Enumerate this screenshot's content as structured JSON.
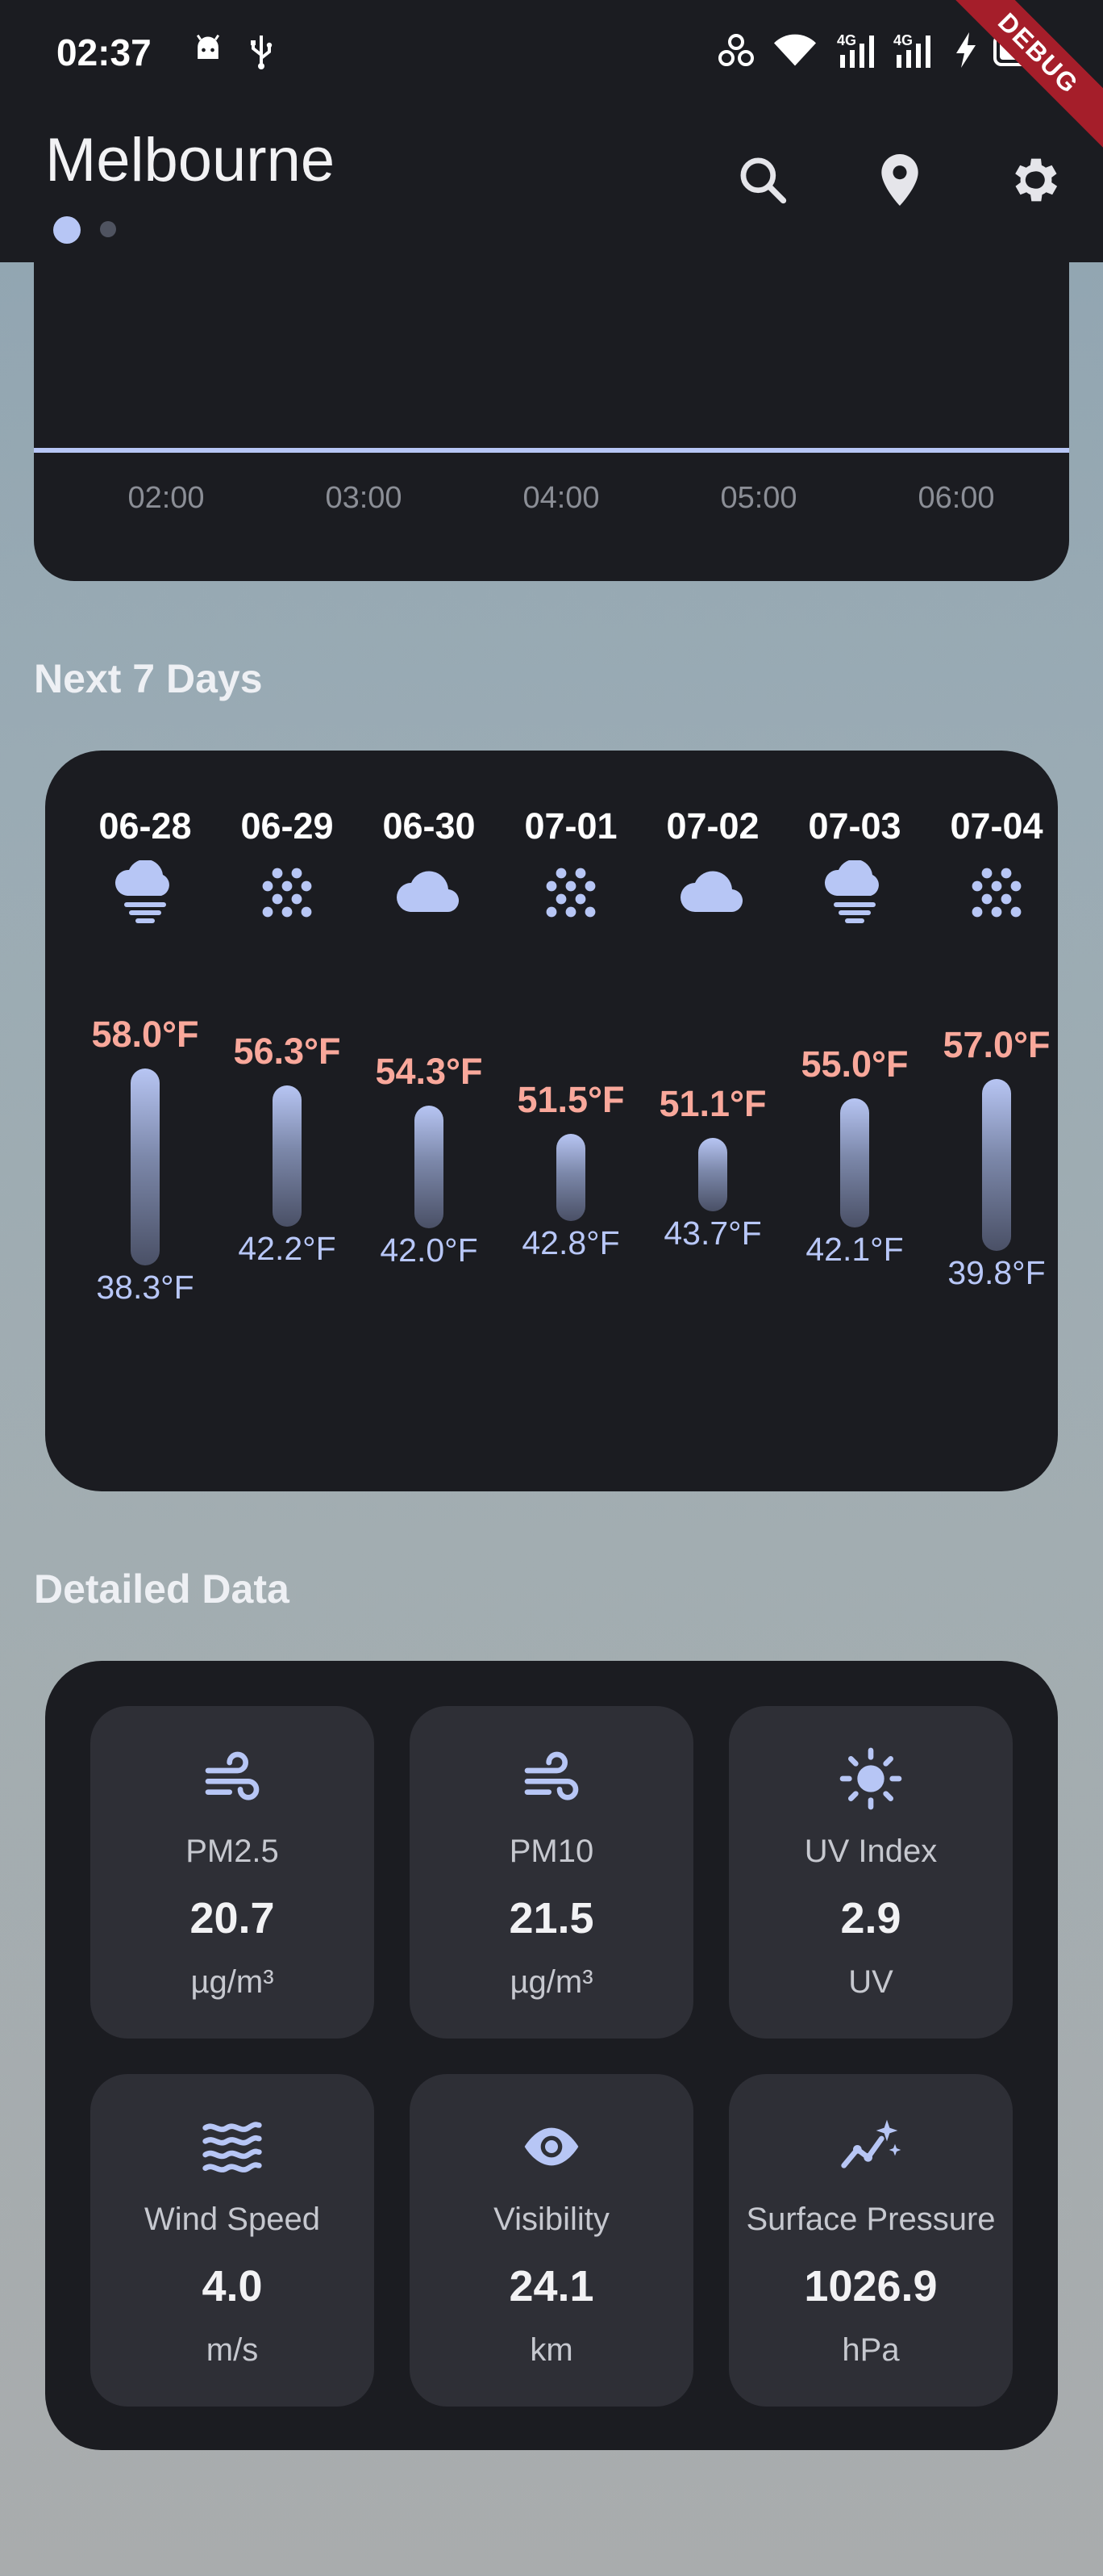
{
  "status_bar": {
    "time": "02:37",
    "icons": [
      "android-icon",
      "usb-icon",
      "pinwheel-icon",
      "wifi-icon",
      "signal-4g-icon",
      "signal-4g-icon",
      "charging-bolt-icon",
      "battery-icon"
    ],
    "network_label_1": "4G",
    "network_label_2": "4G"
  },
  "debug_banner": "DEBUG",
  "header": {
    "city": "Melbourne",
    "page_dots": 2,
    "active_page": 0,
    "actions": [
      "search-icon",
      "location-pin-icon",
      "settings-gear-icon"
    ]
  },
  "hourly": {
    "times": [
      "02:00",
      "03:00",
      "04:00",
      "05:00",
      "06:00"
    ]
  },
  "next_days": {
    "title": "Next 7 Days",
    "days": [
      {
        "date": "06-28",
        "icon": "cloud-fog-icon",
        "high": "58.0°F",
        "low": "38.3°F",
        "high_val": 58.0,
        "low_val": 38.3
      },
      {
        "date": "06-29",
        "icon": "snow-dots-icon",
        "high": "56.3°F",
        "low": "42.2°F",
        "high_val": 56.3,
        "low_val": 42.2
      },
      {
        "date": "06-30",
        "icon": "cloud-icon",
        "high": "54.3°F",
        "low": "42.0°F",
        "high_val": 54.3,
        "low_val": 42.0
      },
      {
        "date": "07-01",
        "icon": "snow-dots-icon",
        "high": "51.5°F",
        "low": "42.8°F",
        "high_val": 51.5,
        "low_val": 42.8
      },
      {
        "date": "07-02",
        "icon": "cloud-icon",
        "high": "51.1°F",
        "low": "43.7°F",
        "high_val": 51.1,
        "low_val": 43.7
      },
      {
        "date": "07-03",
        "icon": "cloud-fog-icon",
        "high": "55.0°F",
        "low": "42.1°F",
        "high_val": 55.0,
        "low_val": 42.1
      },
      {
        "date": "07-04",
        "icon": "snow-dots-icon",
        "high": "57.0°F",
        "low": "39.8°F",
        "high_val": 57.0,
        "low_val": 39.8
      }
    ]
  },
  "details": {
    "title": "Detailed Data",
    "items": [
      {
        "label": "PM2.5",
        "value": "20.7",
        "unit": "µg/m³",
        "icon": "wind-icon"
      },
      {
        "label": "PM10",
        "value": "21.5",
        "unit": "µg/m³",
        "icon": "wind-icon"
      },
      {
        "label": "UV Index",
        "value": "2.9",
        "unit": "UV",
        "icon": "sun-icon"
      },
      {
        "label": "Wind Speed",
        "value": "4.0",
        "unit": "m/s",
        "icon": "waves-icon"
      },
      {
        "label": "Visibility",
        "value": "24.1",
        "unit": "km",
        "icon": "eye-icon"
      },
      {
        "label": "Surface Pressure",
        "value": "1026.9",
        "unit": "hPa",
        "icon": "trend-sparkle-icon"
      }
    ]
  },
  "colors": {
    "card_bg": "#1b1c21",
    "tile_bg": "#2e2f36",
    "high_temp": "#f9a89b",
    "low_temp": "#b8c7f8",
    "accent": "#b7c6f5"
  }
}
